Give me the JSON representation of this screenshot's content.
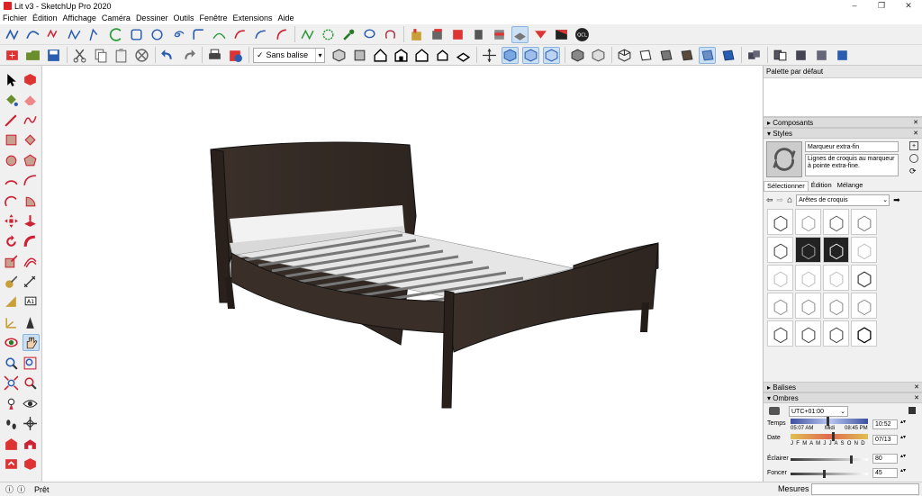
{
  "window": {
    "title": "Lit v3 - SketchUp Pro 2020",
    "min": "–",
    "max": "❐",
    "close": "✕"
  },
  "menu": [
    "Fichier",
    "Édition",
    "Affichage",
    "Caméra",
    "Dessiner",
    "Outils",
    "Fenêtre",
    "Extensions",
    "Aide"
  ],
  "toolbar": {
    "tag_select": "Sans balise"
  },
  "panel": {
    "title": "Palette par défaut",
    "sections": {
      "composants": "Composants",
      "styles": "Styles",
      "balises": "Balises",
      "ombres": "Ombres"
    },
    "style": {
      "name": "Marqueur extra-fin",
      "description": "Lignes de croquis au marqueur à pointe extra-fine.",
      "tabs": [
        "Sélectionner",
        "Édition",
        "Mélange"
      ],
      "collection": "Arêtes de croquis"
    },
    "shadows": {
      "timezone": "UTC+01:00",
      "time_label": "Temps",
      "time_start": "05:07 AM",
      "time_mid": "Midi",
      "time_end": "08:45 PM",
      "time_value": "10:52",
      "date_label": "Date",
      "months": "J F M A M J J A S O N D",
      "date_value": "07/13",
      "light_label": "Éclairer",
      "light_value": "80",
      "dark_label": "Foncer",
      "dark_value": "45"
    }
  },
  "status": {
    "text": "Prêt",
    "measures_label": "Mesures"
  },
  "colors": {
    "accent": "#3d7bd6",
    "wood": "#3a2f28",
    "slat": "#e2e2e2"
  }
}
